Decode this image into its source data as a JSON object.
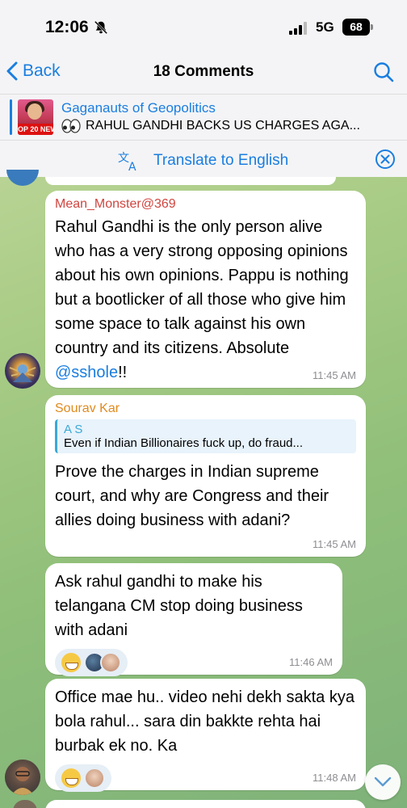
{
  "status": {
    "time": "12:06",
    "network": "5G",
    "battery": "68"
  },
  "nav": {
    "back_label": "Back",
    "title": "18 Comments"
  },
  "channel": {
    "name": "Gaganauts of Geopolitics",
    "post_preview": "RAHUL GANDHI BACKS US CHARGES AGA...",
    "thumb_band": "OP 20 NEW"
  },
  "translate": {
    "label": "Translate to English"
  },
  "messages": [
    {
      "author": "Mean_Monster@369",
      "author_color": "#d0453f",
      "text": "Rahul Gandhi is the only person alive who has a very strong opposing opinions about his own opinions. Pappu is nothing but a bootlicker of all those who give him some space to talk against his own country and its citizens. Absolute ",
      "mention": "@sshole",
      "text_tail": "!!",
      "time": "11:45 AM"
    },
    {
      "author": "Sourav Kar",
      "author_color": "#e08a1e",
      "reply_name": "A S",
      "reply_text": "Even if Indian Billionaires fuck up, do fraud...",
      "text": "Prove the charges in Indian supreme court, and why are Congress and their allies doing business with adani?",
      "time": "11:45 AM"
    },
    {
      "text": "Ask rahul gandhi to make his telangana CM stop doing business with adani",
      "time": "11:46 AM"
    },
    {
      "text": "Office mae hu.. video nehi dekh sakta kya bola rahul... sara din bakkte rehta hai burbak ek no. Ka",
      "time": "11:48 AM"
    }
  ],
  "colors": {
    "accent": "#1a7ee0",
    "wallpaper": "#a9cc86"
  }
}
